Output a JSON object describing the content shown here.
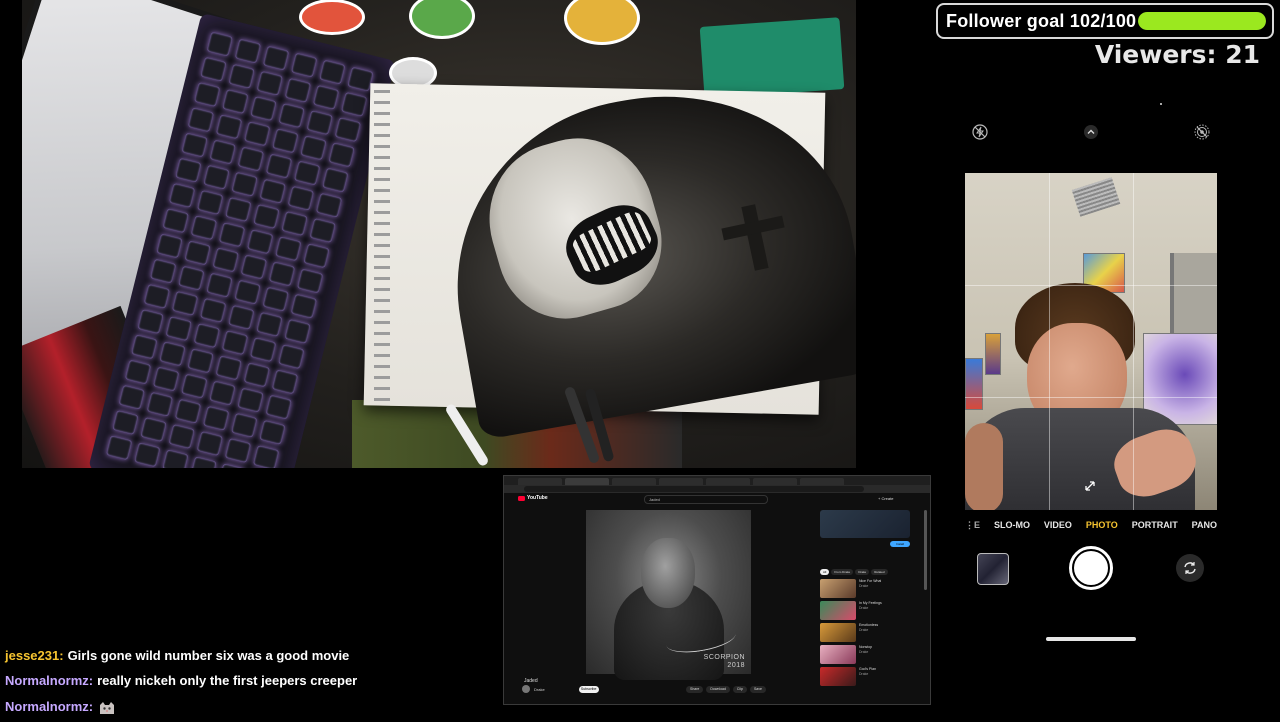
{
  "overlay": {
    "follower_goal_label": "Follower goal 102/100",
    "follower_goal_progress": 1.0,
    "viewers_label": "Viewers: 21",
    "accent_color": "#9be81f"
  },
  "phone_camera": {
    "modes": [
      "SLO-MO",
      "VIDEO",
      "PHOTO",
      "PORTRAIT",
      "PANO"
    ],
    "active_mode": "PHOTO",
    "active_color": "#f6c430",
    "top_icons": [
      "flash-off-icon",
      "chevron-up-icon",
      "live-photo-off-icon"
    ]
  },
  "browser": {
    "site_name": "YouTube",
    "search_query": "Jaded",
    "create_label": "+ Create",
    "album_brand": "SCORPION",
    "album_brand_sub": "2018",
    "video_title": "Jaded",
    "channel_name": "Drake",
    "subscribe_label": "Subscribe",
    "actions": [
      "Share",
      "Download",
      "Clip",
      "Save"
    ],
    "ad_button": "Install",
    "chips": [
      "All",
      "From Drake",
      "Drake",
      "Related"
    ],
    "recommendations": [
      {
        "title": "Nice For What",
        "channel": "Drake"
      },
      {
        "title": "In My Feelings",
        "channel": "Drake"
      },
      {
        "title": "Emotionless",
        "channel": "Drake"
      },
      {
        "title": "Nonstop",
        "channel": "Drake"
      },
      {
        "title": "God's Plan",
        "channel": "Drake"
      }
    ]
  },
  "chat": [
    {
      "user": "jesse231:",
      "user_color": "#f6c430",
      "text": "Girls gone wild number six was a good movie"
    },
    {
      "user": "Normalnormz:",
      "user_color": "#c6a9ff",
      "text": "really nickeh only the first jeepers creeper"
    },
    {
      "user": "Normalnormz:",
      "user_color": "#c6a9ff",
      "text": "",
      "emote": "cat-emote"
    }
  ]
}
